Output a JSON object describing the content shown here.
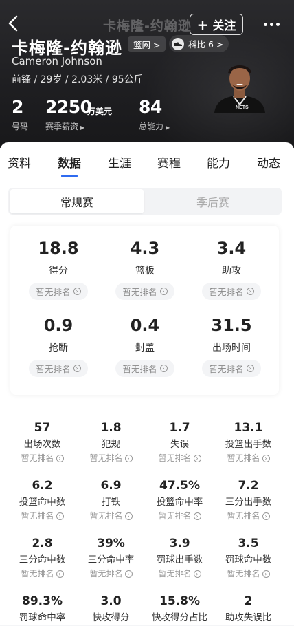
{
  "header": {
    "ghost_title": "卡梅隆-约翰逊",
    "follow_label": "关注",
    "name_cn": "卡梅隆-约翰逊",
    "team_chip": "篮网 >",
    "shoe_chip": "科比 6 >",
    "name_en": "Cameron Johnson",
    "bio": "前锋 / 29岁 / 2.03米 / 95公斤",
    "number_value": "2",
    "number_label": "号码",
    "salary_value": "2250",
    "salary_unit": "万美元",
    "salary_label": "赛季薪资",
    "rating_value": "84",
    "rating_label": "总能力"
  },
  "tabs": [
    "资料",
    "数据",
    "生涯",
    "赛程",
    "能力",
    "动态"
  ],
  "active_tab": "数据",
  "segments": {
    "regular": "常规赛",
    "playoffs": "季后赛"
  },
  "rank_text": "暂无排名",
  "key_stats": [
    {
      "value": "18.8",
      "label": "得分"
    },
    {
      "value": "4.3",
      "label": "篮板"
    },
    {
      "value": "3.4",
      "label": "助攻"
    },
    {
      "value": "0.9",
      "label": "抢断"
    },
    {
      "value": "0.4",
      "label": "封盖"
    },
    {
      "value": "31.5",
      "label": "出场时间"
    }
  ],
  "grid_stats": [
    {
      "value": "57",
      "label": "出场次数"
    },
    {
      "value": "1.8",
      "label": "犯规"
    },
    {
      "value": "1.7",
      "label": "失误"
    },
    {
      "value": "13.1",
      "label": "投篮出手数"
    },
    {
      "value": "6.2",
      "label": "投篮命中数"
    },
    {
      "value": "6.9",
      "label": "打铁"
    },
    {
      "value": "47.5%",
      "label": "投篮命中率"
    },
    {
      "value": "7.2",
      "label": "三分出手数"
    },
    {
      "value": "2.8",
      "label": "三分命中数"
    },
    {
      "value": "39%",
      "label": "三分命中率"
    },
    {
      "value": "3.9",
      "label": "罚球出手数"
    },
    {
      "value": "3.5",
      "label": "罚球命中数"
    },
    {
      "value": "89.3%",
      "label": "罚球命中率"
    },
    {
      "value": "3.0",
      "label": "快攻得分"
    },
    {
      "value": "15.8%",
      "label": "快攻得分占比"
    },
    {
      "value": "2",
      "label": "助攻失误比"
    }
  ],
  "colors": {
    "accent": "#2f6bf0",
    "header_bg": "#1f1f22"
  }
}
